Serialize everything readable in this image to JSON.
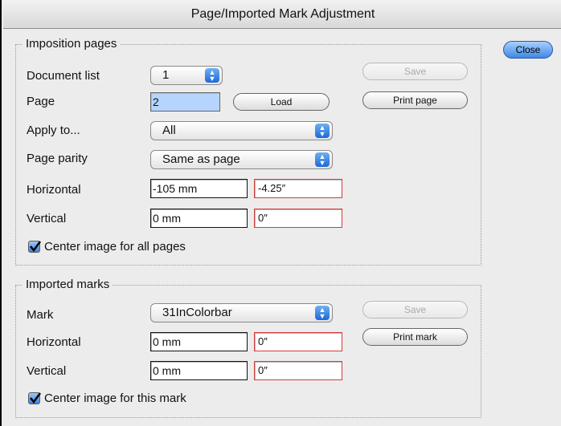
{
  "window": {
    "title": "Page/Imported Mark Adjustment"
  },
  "close_button": "Close",
  "imposition": {
    "title": "Imposition pages",
    "document_list": {
      "label": "Document list",
      "value": "1"
    },
    "save_button": "Save",
    "page": {
      "label": "Page",
      "value": "2"
    },
    "load_button": "Load",
    "print_page_button": "Print page",
    "apply_to": {
      "label": "Apply to...",
      "value": "All"
    },
    "page_parity": {
      "label": "Page parity",
      "value": "Same as page"
    },
    "horizontal": {
      "label": "Horizontal",
      "value": "-105 mm",
      "inches": "-4.25″"
    },
    "vertical": {
      "label": "Vertical",
      "value": "0 mm",
      "inches": "0″"
    },
    "center_all": {
      "label": "Center image for all pages",
      "checked": true
    }
  },
  "imported_marks": {
    "title": "Imported marks",
    "mark": {
      "label": "Mark",
      "value": "31InColorbar"
    },
    "save_button": "Save",
    "print_mark_button": "Print mark",
    "horizontal": {
      "label": "Horizontal",
      "value": "0 mm",
      "inches": "0″"
    },
    "vertical": {
      "label": "Vertical",
      "value": "0 mm",
      "inches": "0″"
    },
    "center_mark": {
      "label": "Center image for this mark",
      "checked": true
    }
  }
}
